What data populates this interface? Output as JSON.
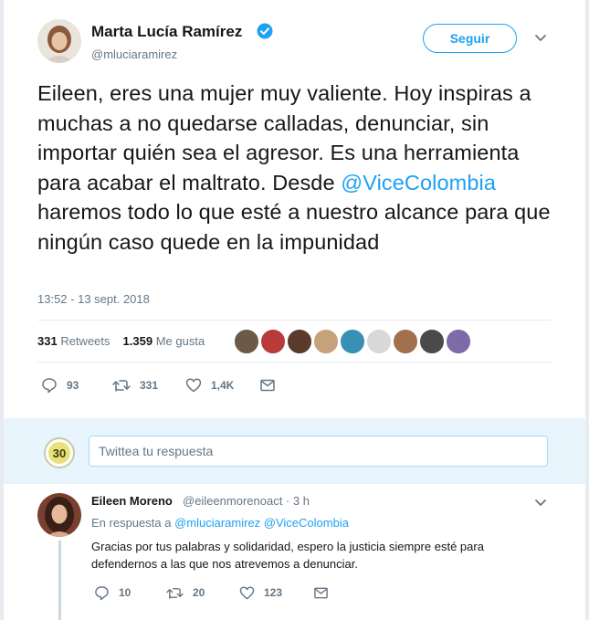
{
  "tweet": {
    "author_name": "Marta Lucía Ramírez",
    "author_handle": "@mluciaramirez",
    "follow_label": "Seguir",
    "text_before": "Eileen, eres una mujer muy valiente. Hoy inspiras a muchas a no quedarse calladas, denunciar, sin importar quién sea el agresor. Es una herramienta para acabar el maltrato. Desde ",
    "mention": "@ViceColombia",
    "text_after": " haremos todo lo que esté a nuestro alcance para que ningún caso quede en la impunidad",
    "timestamp": "13:52 - 13 sept. 2018",
    "retweets_count": "331",
    "retweets_label": "Retweets",
    "likes_count": "1.359",
    "likes_label": "Me gusta",
    "actions": {
      "reply_count": "93",
      "retweet_count": "331",
      "like_count": "1,4K"
    },
    "accent_color": "#1da1f2",
    "verified_icon": "verified-badge-icon"
  },
  "reply_box": {
    "placeholder": "Twittea tu respuesta",
    "avatar_text": "30"
  },
  "reply": {
    "author_name": "Eileen Moreno",
    "author_handle": "@eileenmorenoact · 3 h",
    "in_reply_prefix": "En respuesta a",
    "in_reply_mentions": "@mluciaramirez @ViceColombia",
    "text": "Gracias por tus palabras y solidaridad, espero la justicia siempre esté para defendernos a las que nos atrevemos a denunciar.",
    "actions": {
      "reply_count": "10",
      "retweet_count": "20",
      "like_count": "123"
    }
  }
}
